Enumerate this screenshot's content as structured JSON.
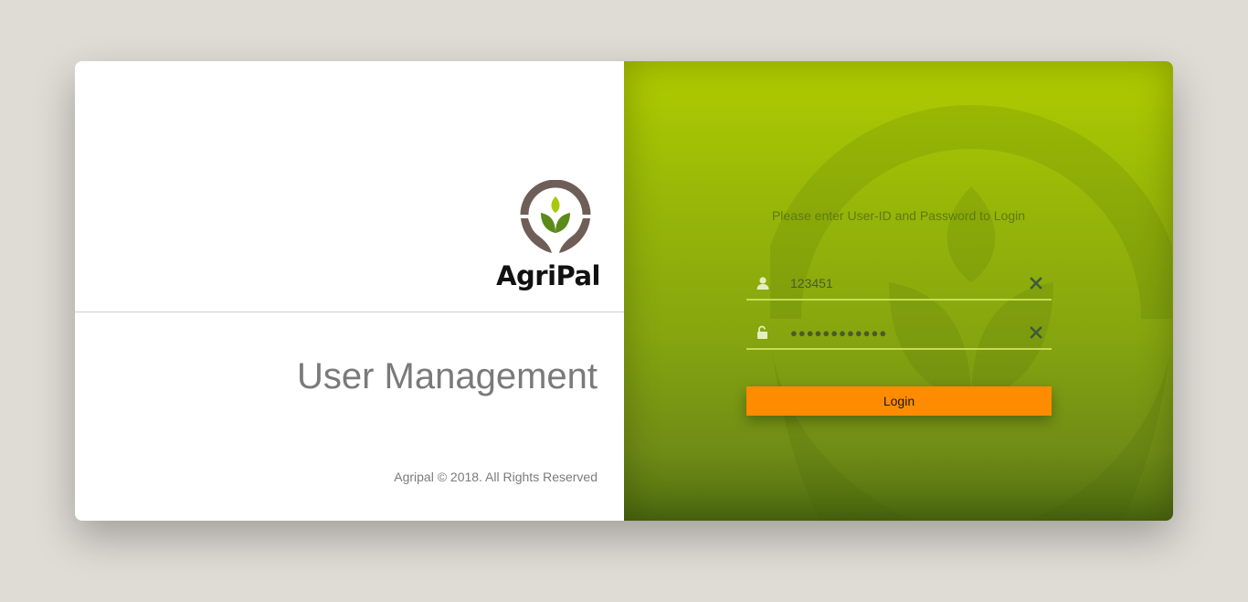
{
  "brand": {
    "name": "AgriPal"
  },
  "app": {
    "title": "User Management"
  },
  "footer": {
    "copyright": "Agripal © 2018. All Rights Reserved"
  },
  "login": {
    "prompt": "Please enter User-ID and Password to Login",
    "user_id_value": "123451",
    "password_value": "●●●●●●●●●●●●",
    "button_label": "Login"
  },
  "icons": {
    "user": "user-icon",
    "password": "unlock-icon",
    "clear": "close-icon",
    "logo": "agripal-logo"
  },
  "colors": {
    "accent": "#ff8c00",
    "panel_green_top": "#b0cd00",
    "panel_green_bottom": "#4e6c10",
    "brand_brown": "#6e5e57",
    "brand_green": "#5b8a1a"
  }
}
